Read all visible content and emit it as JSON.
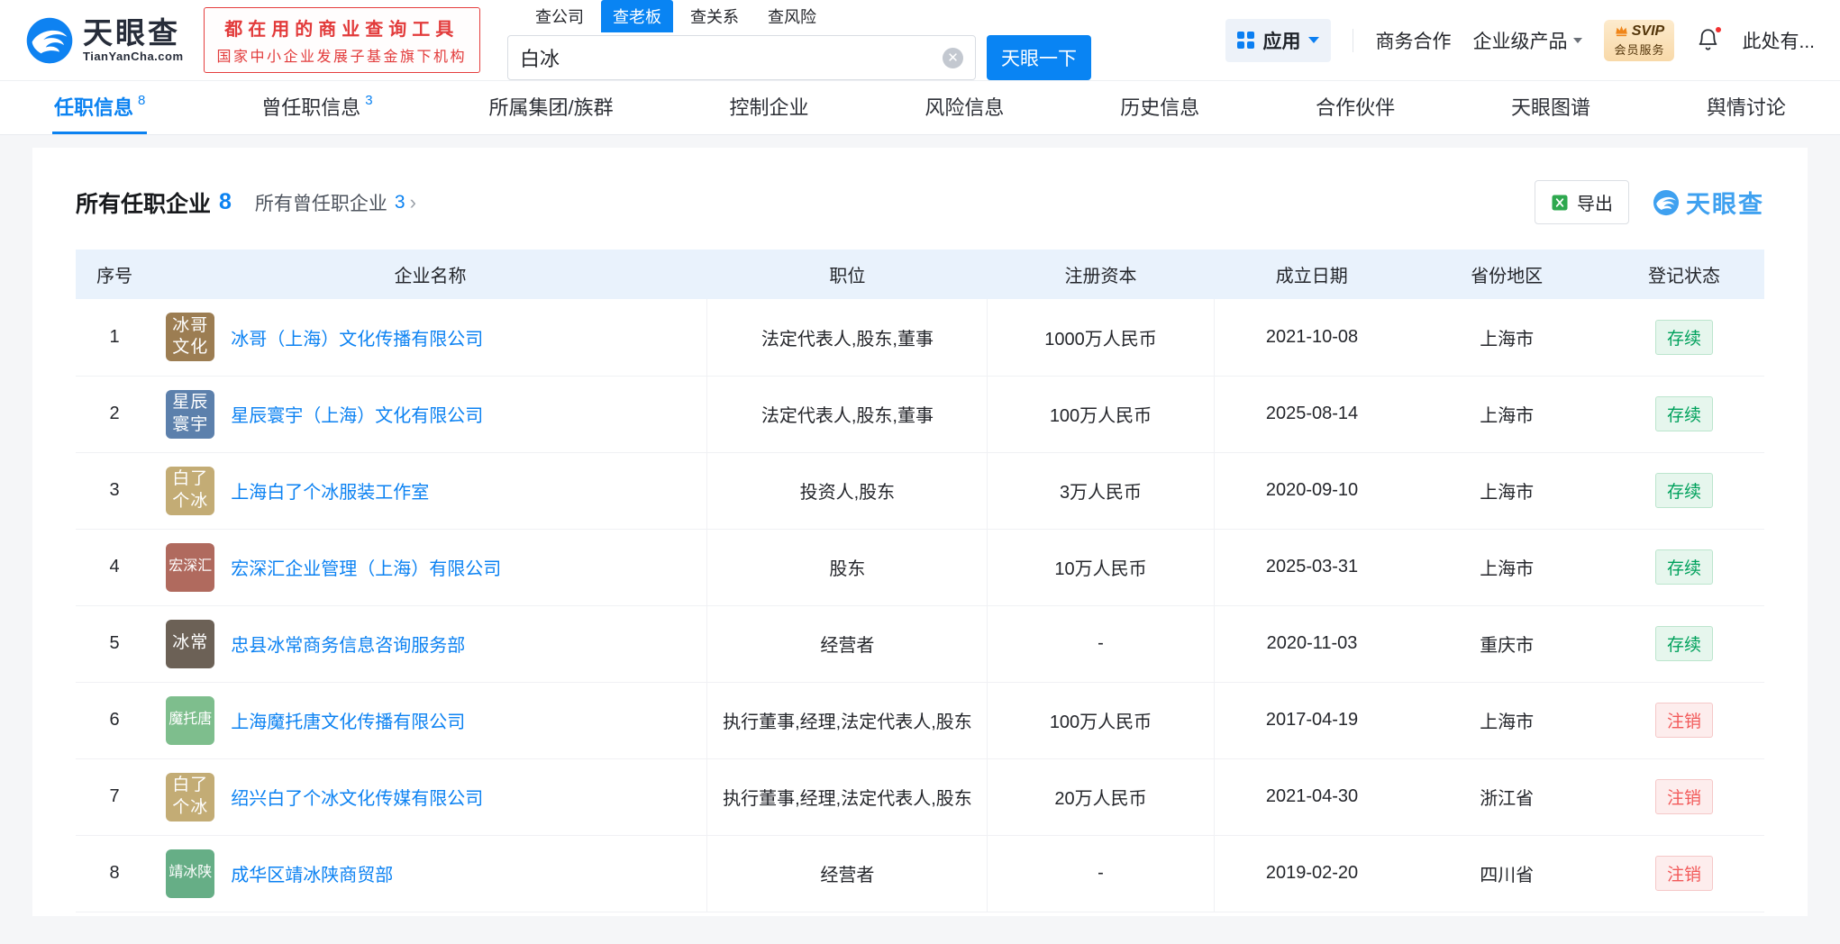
{
  "brand": {
    "name": "天眼查",
    "domain": "TianYanCha.com",
    "blue": "#0984F3"
  },
  "promo": {
    "line1": "都在用的商业查询工具",
    "line2": "国家中小企业发展子基金旗下机构"
  },
  "search": {
    "tabs": [
      {
        "label": "查公司"
      },
      {
        "label": "查老板"
      },
      {
        "label": "查关系"
      },
      {
        "label": "查风险"
      }
    ],
    "active_tab": "查老板",
    "value": "白冰",
    "button_label": "天眼一下"
  },
  "header_menu": {
    "apps": "应用",
    "cooperation": "商务合作",
    "enterprise": "企业级产品",
    "svip_title": "SVIP",
    "svip_subtitle": "会员服务",
    "account": "此处有..."
  },
  "nav_tabs": [
    {
      "label": "任职信息",
      "count": "8"
    },
    {
      "label": "曾任职信息",
      "count": "3"
    },
    {
      "label": "所属集团/族群",
      "count": ""
    },
    {
      "label": "控制企业",
      "count": ""
    },
    {
      "label": "风险信息",
      "count": ""
    },
    {
      "label": "历史信息",
      "count": ""
    },
    {
      "label": "合作伙伴",
      "count": ""
    },
    {
      "label": "天眼图谱",
      "count": ""
    },
    {
      "label": "舆情讨论",
      "count": ""
    }
  ],
  "section": {
    "title": "所有任职企业",
    "title_count": "8",
    "link_label": "所有曾任职企业",
    "link_count": "3",
    "link_arrow": "›",
    "export_label": "导出",
    "watermark_label": "天眼查"
  },
  "table": {
    "headers": [
      "序号",
      "企业名称",
      "职位",
      "注册资本",
      "成立日期",
      "省份地区",
      "登记状态"
    ],
    "status_colors": {
      "active": {
        "text": "#00A15C",
        "bg": "#E6F6ED",
        "border": "#BCE5CD"
      },
      "cancelled": {
        "text": "#F25A5A",
        "bg": "#FDEDED",
        "border": "#F5C8C8"
      }
    },
    "rows": [
      {
        "no": "1",
        "logo_lines": [
          "冰哥",
          "文化"
        ],
        "logo_color": "#9C7D52",
        "company": "冰哥（上海）文化传播有限公司",
        "position": "法定代表人,股东,董事",
        "capital": "1000万人民币",
        "founded": "2021-10-08",
        "region": "上海市",
        "status": "存续",
        "status_type": "active"
      },
      {
        "no": "2",
        "logo_lines": [
          "星辰",
          "寰宇"
        ],
        "logo_color": "#5C80AC",
        "company": "星辰寰宇（上海）文化有限公司",
        "position": "法定代表人,股东,董事",
        "capital": "100万人民币",
        "founded": "2025-08-14",
        "region": "上海市",
        "status": "存续",
        "status_type": "active"
      },
      {
        "no": "3",
        "logo_lines": [
          "白了",
          "个冰"
        ],
        "logo_color": "#C3AC75",
        "company": "上海白了个冰服装工作室",
        "position": "投资人,股东",
        "capital": "3万人民币",
        "founded": "2020-09-10",
        "region": "上海市",
        "status": "存续",
        "status_type": "active"
      },
      {
        "no": "4",
        "logo_lines": [
          "宏深汇"
        ],
        "logo_color": "#B06A5E",
        "company": "宏深汇企业管理（上海）有限公司",
        "position": "股东",
        "capital": "10万人民币",
        "founded": "2025-03-31",
        "region": "上海市",
        "status": "存续",
        "status_type": "active"
      },
      {
        "no": "5",
        "logo_lines": [
          "冰常"
        ],
        "logo_color": "#6C6156",
        "company": "忠县冰常商务信息咨询服务部",
        "position": "经营者",
        "capital": "-",
        "founded": "2020-11-03",
        "region": "重庆市",
        "status": "存续",
        "status_type": "active"
      },
      {
        "no": "6",
        "logo_lines": [
          "魔托唐"
        ],
        "logo_color": "#7EBE8D",
        "company": "上海魔托唐文化传播有限公司",
        "position": "执行董事,经理,法定代表人,股东",
        "capital": "100万人民币",
        "founded": "2017-04-19",
        "region": "上海市",
        "status": "注销",
        "status_type": "cancelled"
      },
      {
        "no": "7",
        "logo_lines": [
          "白了",
          "个冰"
        ],
        "logo_color": "#C3AC75",
        "company": "绍兴白了个冰文化传媒有限公司",
        "position": "执行董事,经理,法定代表人,股东",
        "capital": "20万人民币",
        "founded": "2021-04-30",
        "region": "浙江省",
        "status": "注销",
        "status_type": "cancelled"
      },
      {
        "no": "8",
        "logo_lines": [
          "靖冰陕"
        ],
        "logo_color": "#66AE86",
        "company": "成华区靖冰陕商贸部",
        "position": "经营者",
        "capital": "-",
        "founded": "2019-02-20",
        "region": "四川省",
        "status": "注销",
        "status_type": "cancelled"
      }
    ]
  }
}
